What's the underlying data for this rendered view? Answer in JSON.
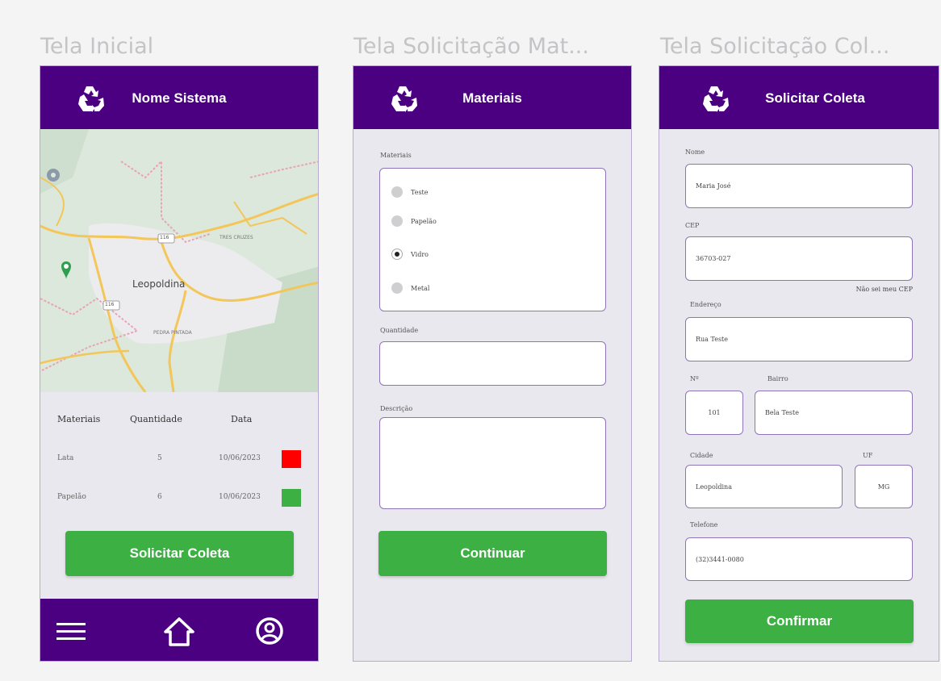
{
  "frames": {
    "home_title": "Tela Inicial",
    "materials_title": "Tela Solicitação Mat...",
    "collect_title": "Tela Solicitação Col..."
  },
  "colors": {
    "brand": "#4b0082",
    "button": "#3cb043",
    "status_red": "#ff0000",
    "status_green": "#3cb043"
  },
  "home": {
    "header_title": "Nome Sistema",
    "logo_icon": "recycle-icon",
    "map": {
      "city_label": "Leopoldina",
      "road_labels": [
        "116",
        "116",
        "TRES CRUZES",
        "PEDRA PINTADA"
      ]
    },
    "table": {
      "headers": [
        "Materiais",
        "Quantidade",
        "Data"
      ],
      "rows": [
        {
          "material": "Lata",
          "quantity": "5",
          "date": "10/06/2023",
          "status": "red"
        },
        {
          "material": "Papelão",
          "quantity": "6",
          "date": "10/06/2023",
          "status": "green"
        }
      ]
    },
    "button_label": "Solicitar Coleta",
    "nav": {
      "menu_icon": "menu-icon",
      "home_icon": "home-icon",
      "profile_icon": "user-icon"
    }
  },
  "materials": {
    "header_title": "Materiais",
    "materials_label": "Materiais",
    "options": [
      {
        "label": "Teste",
        "selected": false
      },
      {
        "label": "Papelão",
        "selected": false
      },
      {
        "label": "Vidro",
        "selected": true
      },
      {
        "label": "Metal",
        "selected": false
      }
    ],
    "quantity_label": "Quantidade",
    "quantity_value": "",
    "description_label": "Descrição",
    "description_value": "",
    "button_label": "Continuar"
  },
  "collect": {
    "header_title": "Solicitar Coleta",
    "name_label": "Nome",
    "name_value": "Maria José",
    "cep_label": "CEP",
    "cep_value": "36703-027",
    "cep_link": "Não sei meu CEP",
    "address_label": "Endereço",
    "address_value": "Rua Teste",
    "number_label": "Nº",
    "number_value": "101",
    "district_label": "Bairro",
    "district_value": "Bela Teste",
    "city_label": "Cidade",
    "city_value": "Leopoldina",
    "uf_label": "UF",
    "uf_value": "MG",
    "phone_label": "Telefone",
    "phone_value": "(32)3441-0080",
    "button_label": "Confirmar"
  }
}
